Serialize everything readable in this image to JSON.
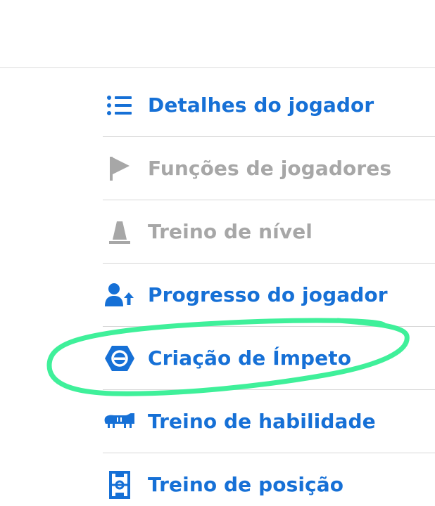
{
  "colors": {
    "accent": "#1670d6",
    "disabled": "#a7a7a7",
    "highlight": "#3ff09a"
  },
  "menu": {
    "items": [
      {
        "label": "Detalhes do jogador",
        "icon": "list-icon",
        "state": "active"
      },
      {
        "label": "Funções de jogadores",
        "icon": "flag-icon",
        "state": "disabled"
      },
      {
        "label": "Treino de nível",
        "icon": "cone-icon",
        "state": "disabled"
      },
      {
        "label": "Progresso do jogador",
        "icon": "user-arrow-up-icon",
        "state": "active"
      },
      {
        "label": "Criação de Ímpeto",
        "icon": "hexagon-momentum-icon",
        "state": "active"
      },
      {
        "label": "Treino de habilidade",
        "icon": "boot-icon",
        "state": "active"
      },
      {
        "label": "Treino de posição",
        "icon": "pitch-icon",
        "state": "active"
      }
    ]
  }
}
